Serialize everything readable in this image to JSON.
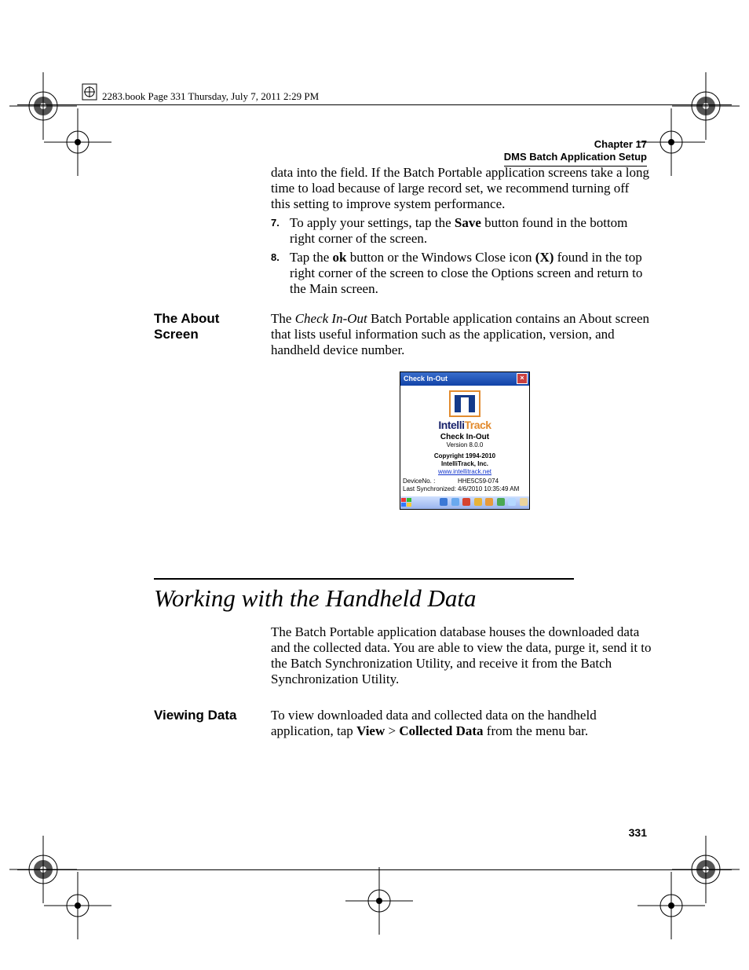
{
  "header": {
    "running_head": "2283.book  Page 331  Thursday, July 7, 2011  2:29 PM",
    "chapter_label": "Chapter 17",
    "chapter_title": "DMS Batch Application Setup"
  },
  "body": {
    "intro_para": "data into the field. If the Batch Portable application screens take a long time to load because of large record set, we recommend turning off this setting to improve system performance.",
    "step7_num": "7.",
    "step7_a": "To apply your settings, tap the ",
    "step7_b": "Save",
    "step7_c": " button found in the bottom right corner of the screen.",
    "step8_num": "8.",
    "step8_a": "Tap the ",
    "step8_b": "ok",
    "step8_c": " button or the Windows Close icon ",
    "step8_d": "(X)",
    "step8_e": " found in the top right corner of the screen to close the Options screen and return to the Main screen.",
    "about_hdr": "The About Screen",
    "about_a": "The ",
    "about_i": "Check In-Out",
    "about_b": " Batch Portable application contains an About screen that lists useful information such as the application, version, and handheld device number.",
    "section_title": "Working with the Handheld Data",
    "working_para": "The Batch Portable application database houses the downloaded data and the collected data. You are able to view the data, purge it, send it to the Batch Synchronization Utility, and receive it from the Batch Synchronization Utility.",
    "viewing_hdr": "Viewing Data",
    "viewing_a": "To view downloaded data and collected data on the handheld application, tap ",
    "viewing_b": "View",
    "viewing_sep": " > ",
    "viewing_c": "Collected Data",
    "viewing_d": " from the menu bar."
  },
  "screenshot": {
    "title": "Check In-Out",
    "brand_1": "Intelli",
    "brand_2": "Track",
    "product": "Check In-Out",
    "version": "Version 8.0.0",
    "copyright": "Copyright 1994-2010",
    "company": "IntelliTrack, Inc.",
    "url": "www.intellitrack.net",
    "dev_label": "DeviceNo. :",
    "dev_val": "HHE5C59-074",
    "sync_label": "Last Synchronized:",
    "sync_val": "4/6/2010 10:35:49 AM"
  },
  "page_number": "331"
}
